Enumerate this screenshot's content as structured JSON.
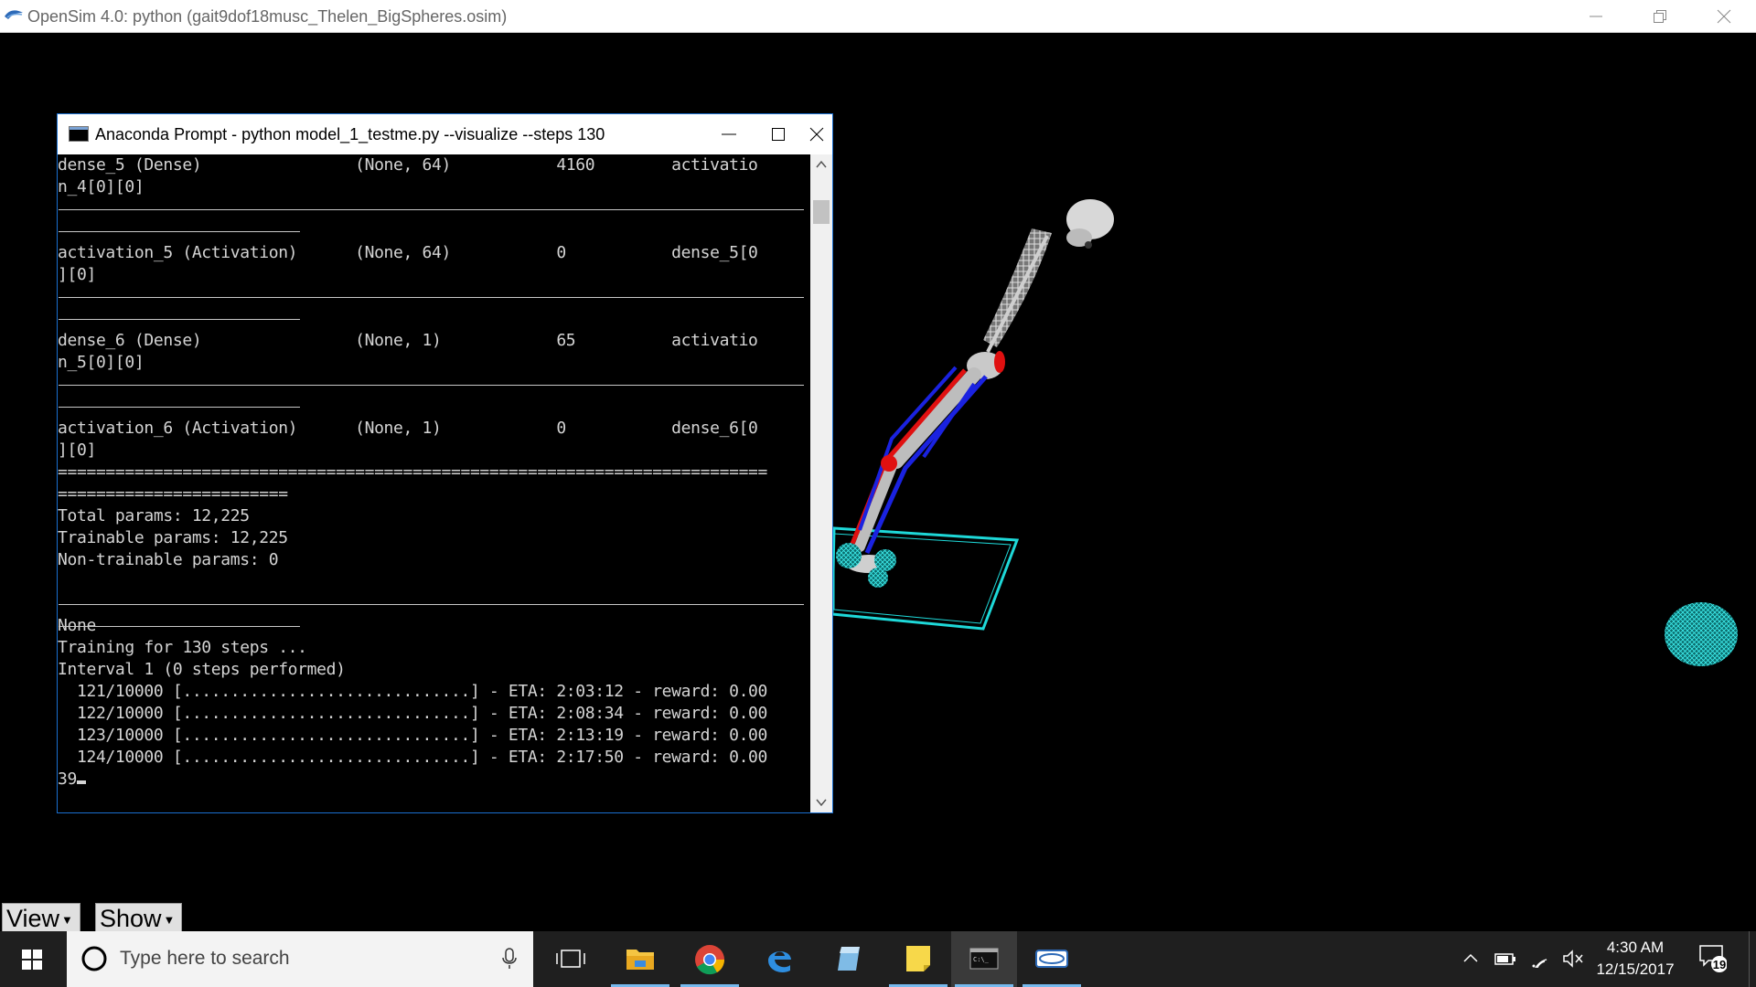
{
  "opensim": {
    "title": "OpenSim 4.0: python (gait9dof18musc_Thelen_BigSpheres.osim)",
    "view_button": "View",
    "show_button": "Show"
  },
  "console": {
    "title": "Anaconda Prompt - python  model_1_testme.py --visualize --steps 130",
    "lines": [
      "dense_5 (Dense)                (None, 64)           4160        activatio",
      "n_4[0][0]",
      "",
      "",
      "activation_5 (Activation)      (None, 64)           0           dense_5[0",
      "][0]",
      "",
      "",
      "dense_6 (Dense)                (None, 1)            65          activatio",
      "n_5[0][0]",
      "",
      "",
      "activation_6 (Activation)      (None, 1)            0           dense_6[0",
      "][0]",
      "==========================================================================",
      "========================",
      "Total params: 12,225",
      "Trainable params: 12,225",
      "Non-trainable params: 0",
      "",
      "",
      "None",
      "Training for 130 steps ...",
      "Interval 1 (0 steps performed)",
      "  121/10000 [..............................] - ETA: 2:03:12 - reward: 0.00",
      "  122/10000 [..............................] - ETA: 2:08:34 - reward: 0.00",
      "  123/10000 [..............................] - ETA: 2:13:19 - reward: 0.00",
      "  124/10000 [..............................] - ETA: 2:17:50 - reward: 0.00",
      "39"
    ]
  },
  "taskbar": {
    "search_placeholder": "Type here to search",
    "apps": [
      "Task View",
      "File Explorer",
      "Google Chrome",
      "Microsoft Edge",
      "Notepad",
      "Sticky Notes",
      "Command Prompt",
      "OpenSim"
    ],
    "clock_time": "4:30 AM",
    "clock_date": "12/15/2017",
    "notification_count": "19"
  },
  "colors": {
    "console_border": "#1a6fd0",
    "muscle_red": "#e01010",
    "muscle_blue": "#1a22e0",
    "contact_cyan": "#1ed8d8"
  }
}
